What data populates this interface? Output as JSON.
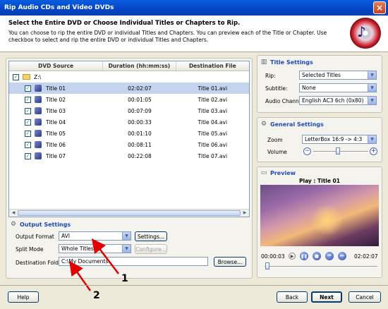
{
  "window": {
    "title": "Rip Audio CDs and Video DVDs",
    "close_glyph": "×"
  },
  "header": {
    "title": "Select the Entire DVD or Choose Individual Titles or Chapters to Rip.",
    "description": "You can choose to rip the entire DVD or individual Titles and Chapters. You can preview each of the Title or Chapter. Use checkbox to select and rip the entire DVD or individual Titles and Chapters."
  },
  "list": {
    "columns": [
      "DVD Source",
      "Duration (hh:mm:ss)",
      "Destination File"
    ],
    "root": "Z:\\",
    "rows": [
      {
        "title": "Title 01",
        "duration": "02:02:07",
        "file": "Title 01.avi"
      },
      {
        "title": "Title 02",
        "duration": "00:01:05",
        "file": "Title 02.avi"
      },
      {
        "title": "Title 03",
        "duration": "00:07:09",
        "file": "Title 03.avi"
      },
      {
        "title": "Title 04",
        "duration": "00:00:33",
        "file": "Title 04.avi"
      },
      {
        "title": "Title 05",
        "duration": "00:01:10",
        "file": "Title 05.avi"
      },
      {
        "title": "Title 06",
        "duration": "00:08:11",
        "file": "Title 06.avi"
      },
      {
        "title": "Title 07",
        "duration": "00:22:08",
        "file": "Title 07.avi"
      }
    ]
  },
  "output_settings": {
    "title": "Output Settings",
    "format_label": "Output Format",
    "format_value": "AVI",
    "settings_button": "Settings...",
    "split_label": "Split Mode",
    "split_value": "Whole Titles",
    "configure_button": "Configure...",
    "dest_label": "Destination Folder",
    "dest_value": "C:\\My Documents",
    "browse_button": "Browse..."
  },
  "title_settings": {
    "title": "Title Settings",
    "rip_label": "Rip:",
    "rip_value": "Selected Titles",
    "subtitle_label": "Subtitle:",
    "subtitle_value": "None",
    "audio_label": "Audio Channel:",
    "audio_value": "English AC3 6ch (0x80)"
  },
  "general_settings": {
    "title": "General Settings",
    "zoom_label": "Zoom",
    "zoom_value": "LetterBox 16:9 -> 4:3",
    "volume_label": "Volume",
    "volume_level": 0.45
  },
  "preview": {
    "title": "Preview",
    "now_playing": "Play : Title 01",
    "time_start": "00:00:03",
    "time_end": "02:02:07"
  },
  "footer": {
    "help": "Help",
    "back": "Back",
    "next": "Next",
    "cancel": "Cancel"
  },
  "annotations": [
    "1",
    "2"
  ]
}
